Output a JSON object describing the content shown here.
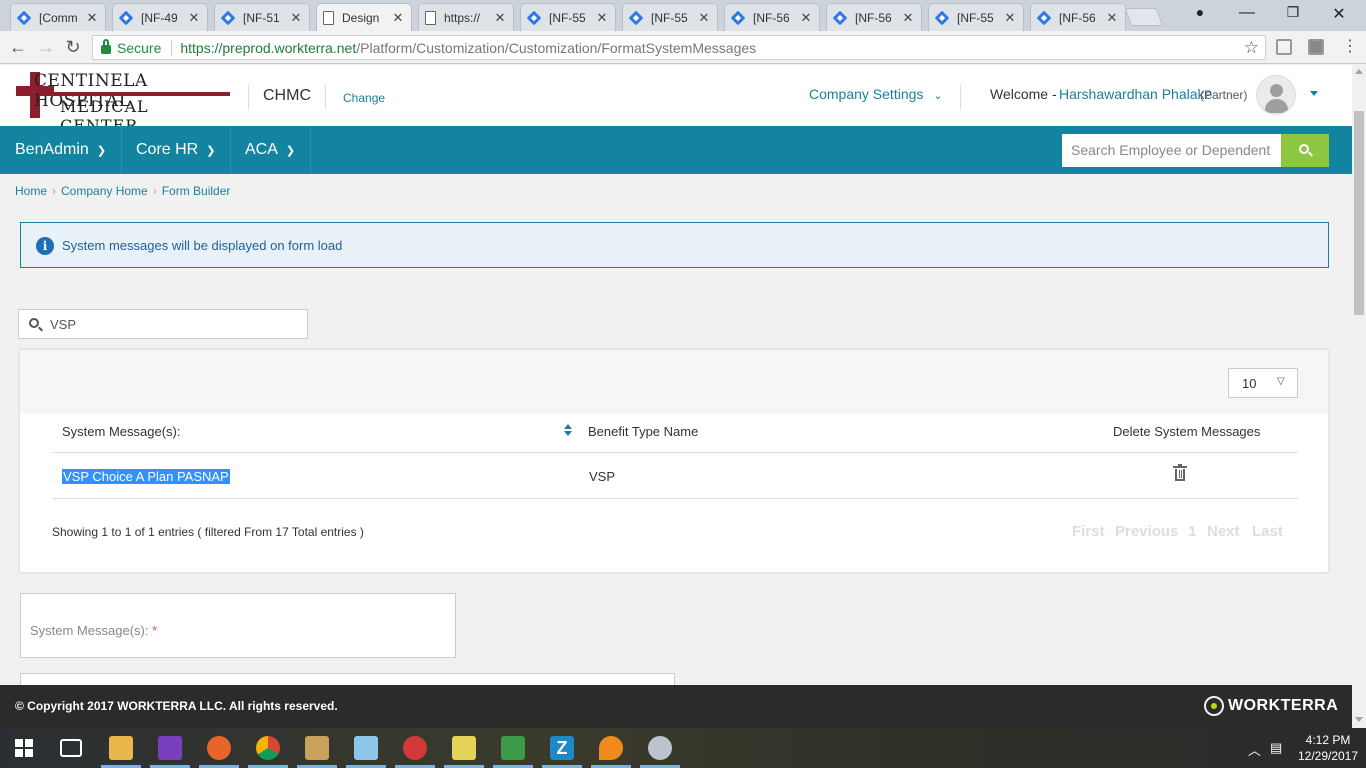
{
  "browser": {
    "tabs": [
      {
        "title": "[Comm",
        "icon": "jira-icon"
      },
      {
        "title": "[NF-49",
        "icon": "jira-icon"
      },
      {
        "title": "[NF-51",
        "icon": "jira-icon"
      },
      {
        "title": "Design",
        "icon": "page-icon"
      },
      {
        "title": "https://",
        "icon": "page-icon"
      },
      {
        "title": "[NF-55",
        "icon": "jira-icon"
      },
      {
        "title": "[NF-55",
        "icon": "jira-icon"
      },
      {
        "title": "[NF-56",
        "icon": "jira-icon"
      },
      {
        "title": "[NF-56",
        "icon": "jira-icon"
      },
      {
        "title": "[NF-55",
        "icon": "jira-icon"
      },
      {
        "title": "[NF-56",
        "icon": "jira-icon"
      }
    ],
    "secure_label": "Secure",
    "url_host": "https://preprod.workterra.net",
    "url_path": "/Platform/Customization/Customization/FormatSystemMessages"
  },
  "header": {
    "logo_line1": "CENTINELA HOSPITAL",
    "logo_line2": "MEDICAL CENTER",
    "company_code": "CHMC",
    "change_label": "Change",
    "company_settings_label": "Company Settings",
    "welcome_label": "Welcome -",
    "user_name": "Harshawardhan Phalake",
    "user_role": "(Partner)"
  },
  "nav": {
    "items": [
      "BenAdmin",
      "Core HR",
      "ACA"
    ],
    "search_placeholder": "Search Employee or Dependent"
  },
  "breadcrumb": [
    "Home",
    "Company Home",
    "Form Builder"
  ],
  "alert": {
    "message": "System messages will be displayed on form load"
  },
  "filter": {
    "value": "VSP"
  },
  "table": {
    "page_size": "10",
    "columns": [
      "System Message(s):",
      "Benefit Type Name",
      "Delete System Messages"
    ],
    "rows": [
      {
        "message": "VSP Choice A Plan PASNAP",
        "benefit_type": "VSP"
      }
    ],
    "info": "Showing 1 to 1 of 1 entries ( filtered From 17 Total entries )",
    "pager": [
      "First",
      "Previous",
      "1",
      "Next",
      "Last"
    ]
  },
  "form": {
    "message_label": "System Message(s):",
    "required_mark": "*"
  },
  "footer": {
    "copyright": "© Copyright 2017 WORKTERRA LLC. All rights reserved.",
    "brand": "WORKTERRA"
  },
  "taskbar": {
    "time": "4:12 PM",
    "date": "12/29/2017"
  },
  "colors": {
    "nav_bg": "#13849f",
    "accent": "#1a7f9c",
    "search_btn": "#8dc641",
    "footer_bg": "#2b2b2b",
    "brand_red": "#8b1f2d"
  }
}
